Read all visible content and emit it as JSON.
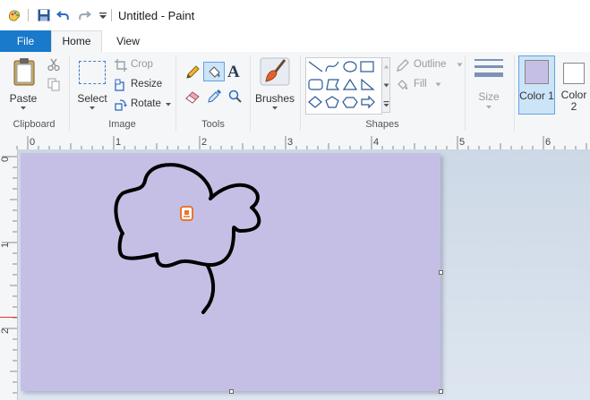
{
  "window": {
    "title": "Untitled - Paint"
  },
  "tabs": {
    "file": "File",
    "home": "Home",
    "view": "View"
  },
  "clipboard": {
    "paste": "Paste",
    "label": "Clipboard"
  },
  "image": {
    "select": "Select",
    "crop": "Crop",
    "resize": "Resize",
    "rotate": "Rotate",
    "label": "Image"
  },
  "tools": {
    "label": "Tools"
  },
  "brushes": {
    "label": "Brushes"
  },
  "shapes": {
    "outline": "Outline",
    "fill": "Fill",
    "label": "Shapes"
  },
  "size": {
    "label": "Size"
  },
  "colors": {
    "color1": "Color 1",
    "color2": "Color 2",
    "color1_value": "#c5bfe6",
    "color2_value": "#ffffff"
  },
  "ruler": {
    "horizontal": [
      "0",
      "1",
      "2",
      "3",
      "4",
      "5",
      "6"
    ],
    "vertical": [
      "0",
      "1",
      "2"
    ]
  },
  "theme": {
    "accent": "#1979ca",
    "canvas": "#c5bfe6",
    "selected": "#cce4f7"
  }
}
